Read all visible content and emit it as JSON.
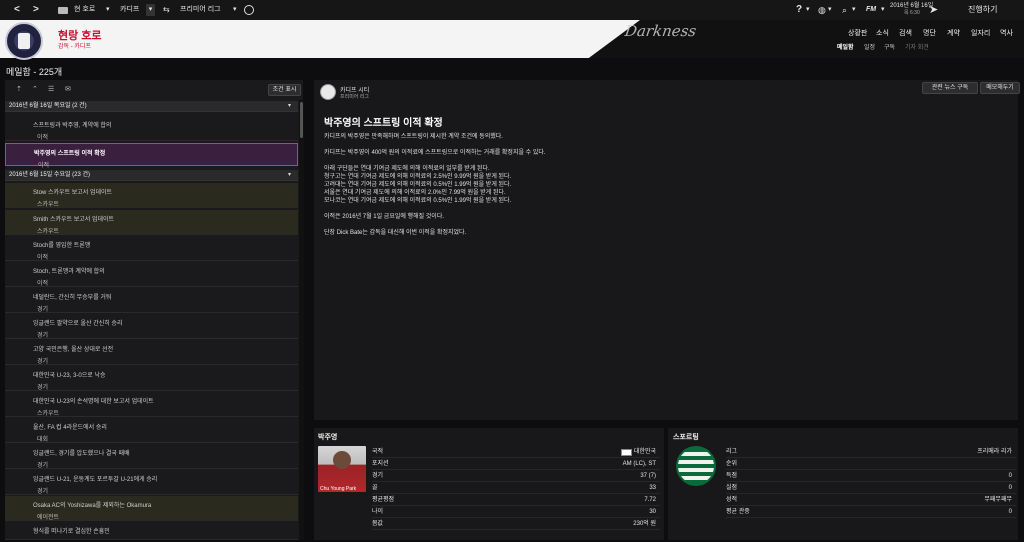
{
  "topbar": {
    "home_club": "현 호로",
    "nav_club": "카디프",
    "league": "프리미어 리그",
    "date_line1": "2016년 6월 16일",
    "date_line2": "목 6:30",
    "continue_label": "진행하기",
    "search_label": "FM"
  },
  "header": {
    "team_name": "현랑 호로",
    "team_sub": "감독 - 카디프",
    "skin_name": "Darkness",
    "main_nav": [
      "상황판",
      "소식",
      "검색",
      "명단",
      "계약",
      "일자리",
      "역사"
    ],
    "sub_nav": [
      "메일함",
      "일정",
      "구독",
      "기자 회견"
    ]
  },
  "page": {
    "title": "메일함 - 225개"
  },
  "inbox": {
    "filter_button": "조건 표시",
    "groups": [
      {
        "date": "2016년 6월 16일 목요일 (2 건)",
        "items": [
          {
            "title": "스프트링과 박주영, 계약에 합의",
            "category": "이적",
            "selected": false,
            "highlight": false
          },
          {
            "title": "박주영의 스프트링 이적 확정",
            "category": "이적",
            "selected": true,
            "highlight": false
          }
        ]
      },
      {
        "date": "2016년 6월 15일 수요일 (23 건)",
        "items": [
          {
            "title": "Stow 스카우트 보고서 업데이트",
            "category": "스카우트",
            "selected": false,
            "highlight": true
          },
          {
            "title": "Smith 스카우트 보고서 업데이트",
            "category": "스카우트",
            "selected": false,
            "highlight": true
          },
          {
            "title": "Stoch를 영입한 트론맹",
            "category": "이적",
            "selected": false,
            "highlight": false
          },
          {
            "title": "Stoch, 트론맹과 계약에 합의",
            "category": "이적",
            "selected": false,
            "highlight": false
          },
          {
            "title": "네덜란드, 간신히 무승부를 거둬",
            "category": "경기",
            "selected": false,
            "highlight": false
          },
          {
            "title": "잉글랜드 팔약으로 올산 간신히 승리",
            "category": "경기",
            "selected": false,
            "highlight": false
          },
          {
            "title": "고양 국민은행, 올산 상대로 선전",
            "category": "경기",
            "selected": false,
            "highlight": false
          },
          {
            "title": "대한민국 U-23, 3-0으로 낙승",
            "category": "경기",
            "selected": false,
            "highlight": false
          },
          {
            "title": "대한민국 U-23의 손석명에 대한 보고서 업데이트",
            "category": "스카우트",
            "selected": false,
            "highlight": false
          },
          {
            "title": "울산, FA 컵 4라운드에서 승리",
            "category": "대회",
            "selected": false,
            "highlight": false
          },
          {
            "title": "잉글랜드, 경기를 압도했으나 결국 패배",
            "category": "경기",
            "selected": false,
            "highlight": false
          },
          {
            "title": "잉글랜드 U-21, 운동계도 포르투갈 U-21에게 승리",
            "category": "경기",
            "selected": false,
            "highlight": false
          },
          {
            "title": "Osaka AC의 Yoshizawa를 제외하는 Okamura",
            "category": "에이전트",
            "selected": false,
            "highlight": true
          },
          {
            "title": "형식를 떠나기로 결심한 손흥민",
            "category": "",
            "selected": false,
            "highlight": false
          }
        ]
      }
    ]
  },
  "message": {
    "sender": "카디프 시티",
    "sender_sub": "프리미어 리그",
    "related_button": "관련 뉴스 구독",
    "memo_button": "메모해두기",
    "headline": "박주영의 스프트링 이적 확정",
    "paragraphs": [
      "카디프의 박주영은 만족해하며 스프트링이 제시한 계약 조건에 동의했다.",
      "카디프는 박주영이 400억 원의 이적료에 스프트링으로 이적하는 거래를 확정지을 수 있다.",
      "아래 구단들은 연대 기여금 제도에 의해 이적료의 일부를 받게 된다.",
      "청구고는 연대 기여금 제도에 의해 이적료의 2.5%인 9.99억 원을 받게 된다.",
      "고려대는 연대 기여금 제도에 의해 이적료의 0.5%인 1.99억 원을 받게 된다.",
      "서울은 연대 기여금 제도에 의해 이적료의 2.0%인 7.99억 원을 받게 된다.",
      "모나코는 연대 기여금 제도에 의해 이적료의 0.5%인 1.99억 원을 받게 된다.",
      "이적은 2016년 7월 1일 금요일에 행해질 것이다.",
      "단장 Dick Bate는 감독을 대신해 이번 이적을 확정지었다."
    ]
  },
  "player_card": {
    "title": "박주영",
    "photo_caption": "Chu Young Park",
    "rows": [
      {
        "k": "국적",
        "v": "대한민국"
      },
      {
        "k": "포지션",
        "v": "AM (LC), ST"
      },
      {
        "k": "경기",
        "v": "37 (7)"
      },
      {
        "k": "골",
        "v": "33"
      },
      {
        "k": "평균평점",
        "v": "7.72"
      },
      {
        "k": "나이",
        "v": "30"
      },
      {
        "k": "몸값",
        "v": "230억 원"
      }
    ]
  },
  "club_card": {
    "title": "스포르팅",
    "rows": [
      {
        "k": "리그",
        "v": "프리메라 리가"
      },
      {
        "k": "순위",
        "v": ""
      },
      {
        "k": "득점",
        "v": "0"
      },
      {
        "k": "실점",
        "v": "0"
      },
      {
        "k": "성적",
        "v": "무패무패무"
      },
      {
        "k": "평균 관중",
        "v": "0"
      }
    ]
  },
  "colors": {
    "accent": "#c8102e",
    "selected_border": "#c03a8a",
    "background": "#0d0d0f"
  }
}
